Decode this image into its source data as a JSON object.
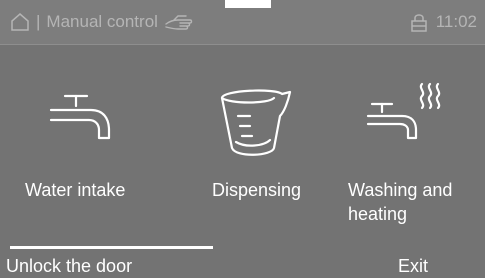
{
  "status_bar": {
    "breadcrumb_separator": "|",
    "title": "Manual control",
    "time": "11:02",
    "icons": [
      "home-icon",
      "hand-touch-icon",
      "lock-icon"
    ]
  },
  "tiles": [
    {
      "label": "Water intake",
      "icon": "water-tap-icon"
    },
    {
      "label": "Dispensing",
      "icon": "measuring-jug-icon"
    },
    {
      "label": "Washing and heating",
      "icon": "tap-with-steam-icon"
    }
  ],
  "bottom_bar": {
    "left_label": "Unlock the door",
    "right_label": "Exit"
  },
  "colors": {
    "background": "#737373",
    "status_bar": "#7d7d7d",
    "status_text": "#b5b5b5",
    "text": "#ffffff"
  }
}
